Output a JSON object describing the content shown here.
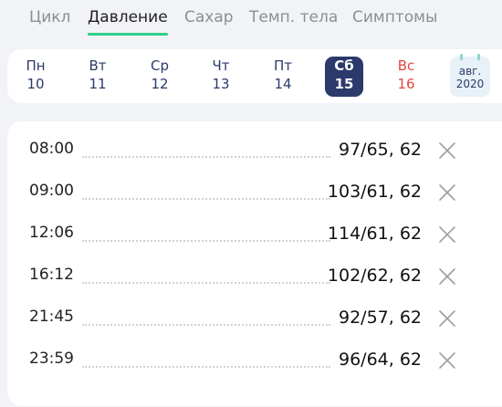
{
  "tabs": [
    {
      "label": "Цикл",
      "active": false
    },
    {
      "label": "Давление",
      "active": true
    },
    {
      "label": "Сахар",
      "active": false
    },
    {
      "label": "Темп. тела",
      "active": false
    },
    {
      "label": "Симптомы",
      "active": false
    }
  ],
  "colors": {
    "accent": "#2fcf8a",
    "selected_day": "#2b3a6b",
    "sunday": "#e2453f",
    "calendar_bg": "#e7f1f7"
  },
  "week": {
    "days": [
      {
        "name": "Пн",
        "date": "10"
      },
      {
        "name": "Вт",
        "date": "11"
      },
      {
        "name": "Ср",
        "date": "12"
      },
      {
        "name": "Чт",
        "date": "13"
      },
      {
        "name": "Пт",
        "date": "14"
      },
      {
        "name": "Сб",
        "date": "15",
        "selected": true
      },
      {
        "name": "Вс",
        "date": "16",
        "sunday": true
      }
    ],
    "calendar": {
      "month": "авг.",
      "year": "2020",
      "icon": "calendar-icon"
    }
  },
  "readings": [
    {
      "time": "08:00",
      "value": "97/65, 62"
    },
    {
      "time": "09:00",
      "value": "103/61, 62"
    },
    {
      "time": "12:06",
      "value": "114/61, 62"
    },
    {
      "time": "16:12",
      "value": "102/62, 62"
    },
    {
      "time": "21:45",
      "value": "92/57, 62"
    },
    {
      "time": "23:59",
      "value": "96/64, 62"
    }
  ],
  "delete_icon": "close-icon"
}
